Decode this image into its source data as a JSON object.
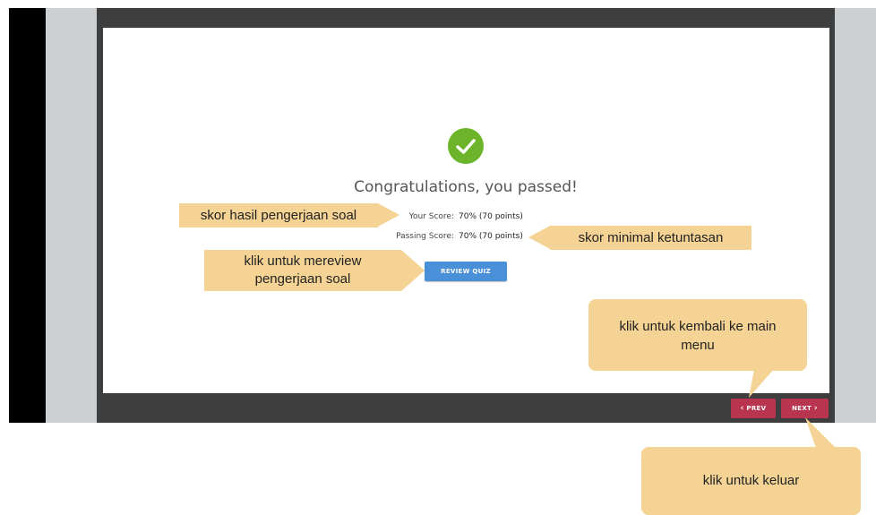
{
  "quiz": {
    "title": "Congratulations, you passed!",
    "your_score_label": "Your Score:",
    "your_score_value": "70% (70 points)",
    "passing_score_label": "Passing Score:",
    "passing_score_value": "70% (70 points)",
    "review_button": "REVIEW QUIZ",
    "prev_button": "PREV",
    "next_button": "NEXT"
  },
  "annotations": {
    "score_note": "skor hasil pengerjaan soal",
    "passing_note": "skor minimal ketuntasan",
    "review_note_line1": "klik untuk mereview",
    "review_note_line2": "pengerjaan soal",
    "menu_note_line1": "klik untuk kembali ke main",
    "menu_note_line2": "menu",
    "exit_note": "klik untuk keluar"
  },
  "icons": {
    "success": "check-circle-icon",
    "prev": "chevron-left-icon",
    "next": "chevron-right-icon"
  },
  "colors": {
    "success": "#6cb52a",
    "review_button": "#4a90d9",
    "nav_button": "#b9354f",
    "callout": "#f5d395",
    "player_frame": "#3e3e3e"
  }
}
